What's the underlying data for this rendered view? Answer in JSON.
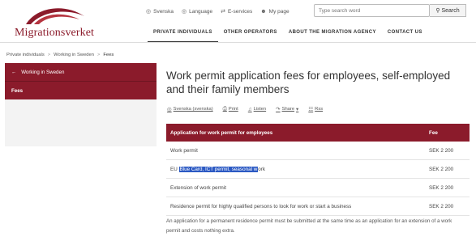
{
  "brand": {
    "name": "Migrationsverket",
    "color": "#8b1b2b"
  },
  "utility_links": [
    {
      "icon": "globe-icon",
      "label": "Svenska"
    },
    {
      "icon": "globe-icon",
      "label": "Language"
    },
    {
      "icon": "arrows-icon",
      "label": "E-services"
    },
    {
      "icon": "user-icon",
      "label": "My page"
    }
  ],
  "search": {
    "placeholder": "Type search word",
    "button_label": "Search",
    "icon": "search-icon"
  },
  "main_nav": [
    {
      "label": "PRIVATE INDIVIDUALS",
      "active": true
    },
    {
      "label": "OTHER OPERATORS",
      "active": false
    },
    {
      "label": "ABOUT THE MIGRATION AGENCY",
      "active": false
    },
    {
      "label": "CONTACT US",
      "active": false
    }
  ],
  "breadcrumb": [
    "Private individuals",
    "Working in Sweden",
    "Fees"
  ],
  "sidenav": {
    "back_label": "Working in Sweden",
    "active_label": "Fees"
  },
  "page": {
    "title": "Work permit application fees for employees, self-employed and their family members"
  },
  "share_bar": [
    {
      "icon": "globe-icon",
      "label": "Svenska (svenska)"
    },
    {
      "icon": "print-icon",
      "label": "Print"
    },
    {
      "icon": "speaker-icon",
      "label": "Listen"
    },
    {
      "icon": "share-icon",
      "label": "Share"
    },
    {
      "icon": "rss-icon",
      "label": "Rss"
    }
  ],
  "fee_table": {
    "headers": [
      "Application for work permit for employees",
      "Fee"
    ],
    "rows": [
      {
        "application": "Work permit",
        "fee": "SEK 2 200"
      },
      {
        "application_pre": "EU ",
        "application_highlight": "Blue Card, ICT permit, seasonal w",
        "application_post": "ork",
        "fee": "SEK 2 200"
      },
      {
        "application": "Extension of work permit",
        "fee": "SEK 2 200"
      },
      {
        "application": "Residence permit for highly qualified persons to look for work or start a business",
        "fee": "SEK 2 200"
      }
    ]
  },
  "note": "An application for a permanent residence permit must be submitted at the same time as an application for an extension of a work permit and costs nothing extra."
}
